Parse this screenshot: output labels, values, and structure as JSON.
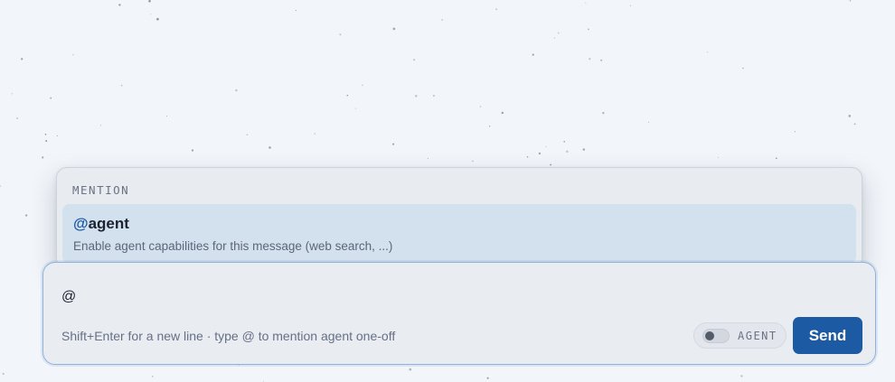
{
  "composer": {
    "input_value": "@",
    "hint": "Shift+Enter for a new line · type @ to mention agent one-off",
    "agent_toggle": {
      "label": "AGENT",
      "enabled": false
    },
    "send_label": "Send"
  },
  "mention_popup": {
    "heading": "MENTION",
    "options": [
      {
        "prefix": "@",
        "name": "agent",
        "description": "Enable agent capabilities for this message (web search, ...)",
        "highlighted": true
      }
    ]
  },
  "colors": {
    "background": "#f2f5fa",
    "accent": "#1c5aa3",
    "popup_highlight": "#d3e0ee"
  }
}
